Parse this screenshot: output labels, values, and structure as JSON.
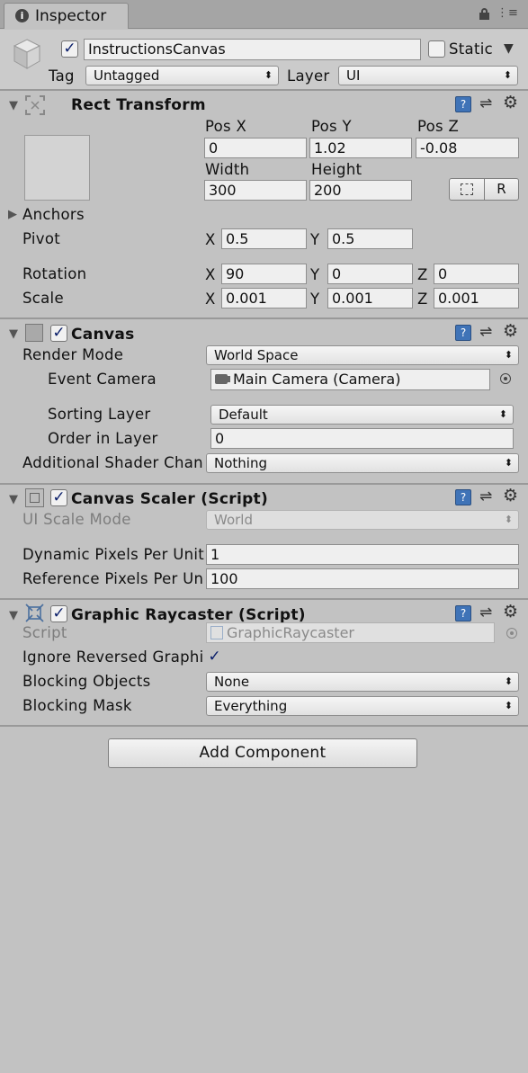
{
  "tab": {
    "title": "Inspector",
    "info_icon": "info-icon",
    "lock_icon": "lock-icon",
    "menu_icon": "menu-icon"
  },
  "gameobject": {
    "name": "InstructionsCanvas",
    "active": true,
    "static_label": "Static",
    "static_checked": false,
    "tag_label": "Tag",
    "tag_value": "Untagged",
    "layer_label": "Layer",
    "layer_value": "UI"
  },
  "rect_transform": {
    "title": "Rect Transform",
    "pos_x_label": "Pos X",
    "pos_y_label": "Pos Y",
    "pos_z_label": "Pos Z",
    "pos_x": "0",
    "pos_y": "1.02",
    "pos_z": "-0.08",
    "width_label": "Width",
    "height_label": "Height",
    "width": "300",
    "height": "200",
    "r_button": "R",
    "anchors_label": "Anchors",
    "pivot_label": "Pivot",
    "pivot_x": "0.5",
    "pivot_y": "0.5",
    "rotation_label": "Rotation",
    "rot_x": "90",
    "rot_y": "0",
    "rot_z": "0",
    "scale_label": "Scale",
    "scale_x": "0.001",
    "scale_y": "0.001",
    "scale_z": "0.001",
    "x": "X",
    "y": "Y",
    "z": "Z"
  },
  "canvas": {
    "title": "Canvas",
    "enabled": true,
    "render_mode_label": "Render Mode",
    "render_mode": "World Space",
    "event_camera_label": "Event Camera",
    "event_camera": "Main Camera (Camera)",
    "sorting_layer_label": "Sorting Layer",
    "sorting_layer": "Default",
    "order_label": "Order in Layer",
    "order": "0",
    "shader_label": "Additional Shader Chan",
    "shader_value": "Nothing"
  },
  "canvas_scaler": {
    "title": "Canvas Scaler (Script)",
    "enabled": true,
    "ui_scale_mode_label": "UI Scale Mode",
    "ui_scale_mode": "World",
    "dynamic_label": "Dynamic Pixels Per Unit",
    "dynamic_value": "1",
    "reference_label": "Reference Pixels Per Un",
    "reference_value": "100"
  },
  "graphic_raycaster": {
    "title": "Graphic Raycaster (Script)",
    "enabled": true,
    "script_label": "Script",
    "script_value": "GraphicRaycaster",
    "ignore_label": "Ignore Reversed Graphi",
    "ignore_checked": true,
    "blocking_objects_label": "Blocking Objects",
    "blocking_objects": "None",
    "blocking_mask_label": "Blocking Mask",
    "blocking_mask": "Everything"
  },
  "add_component_label": "Add Component"
}
